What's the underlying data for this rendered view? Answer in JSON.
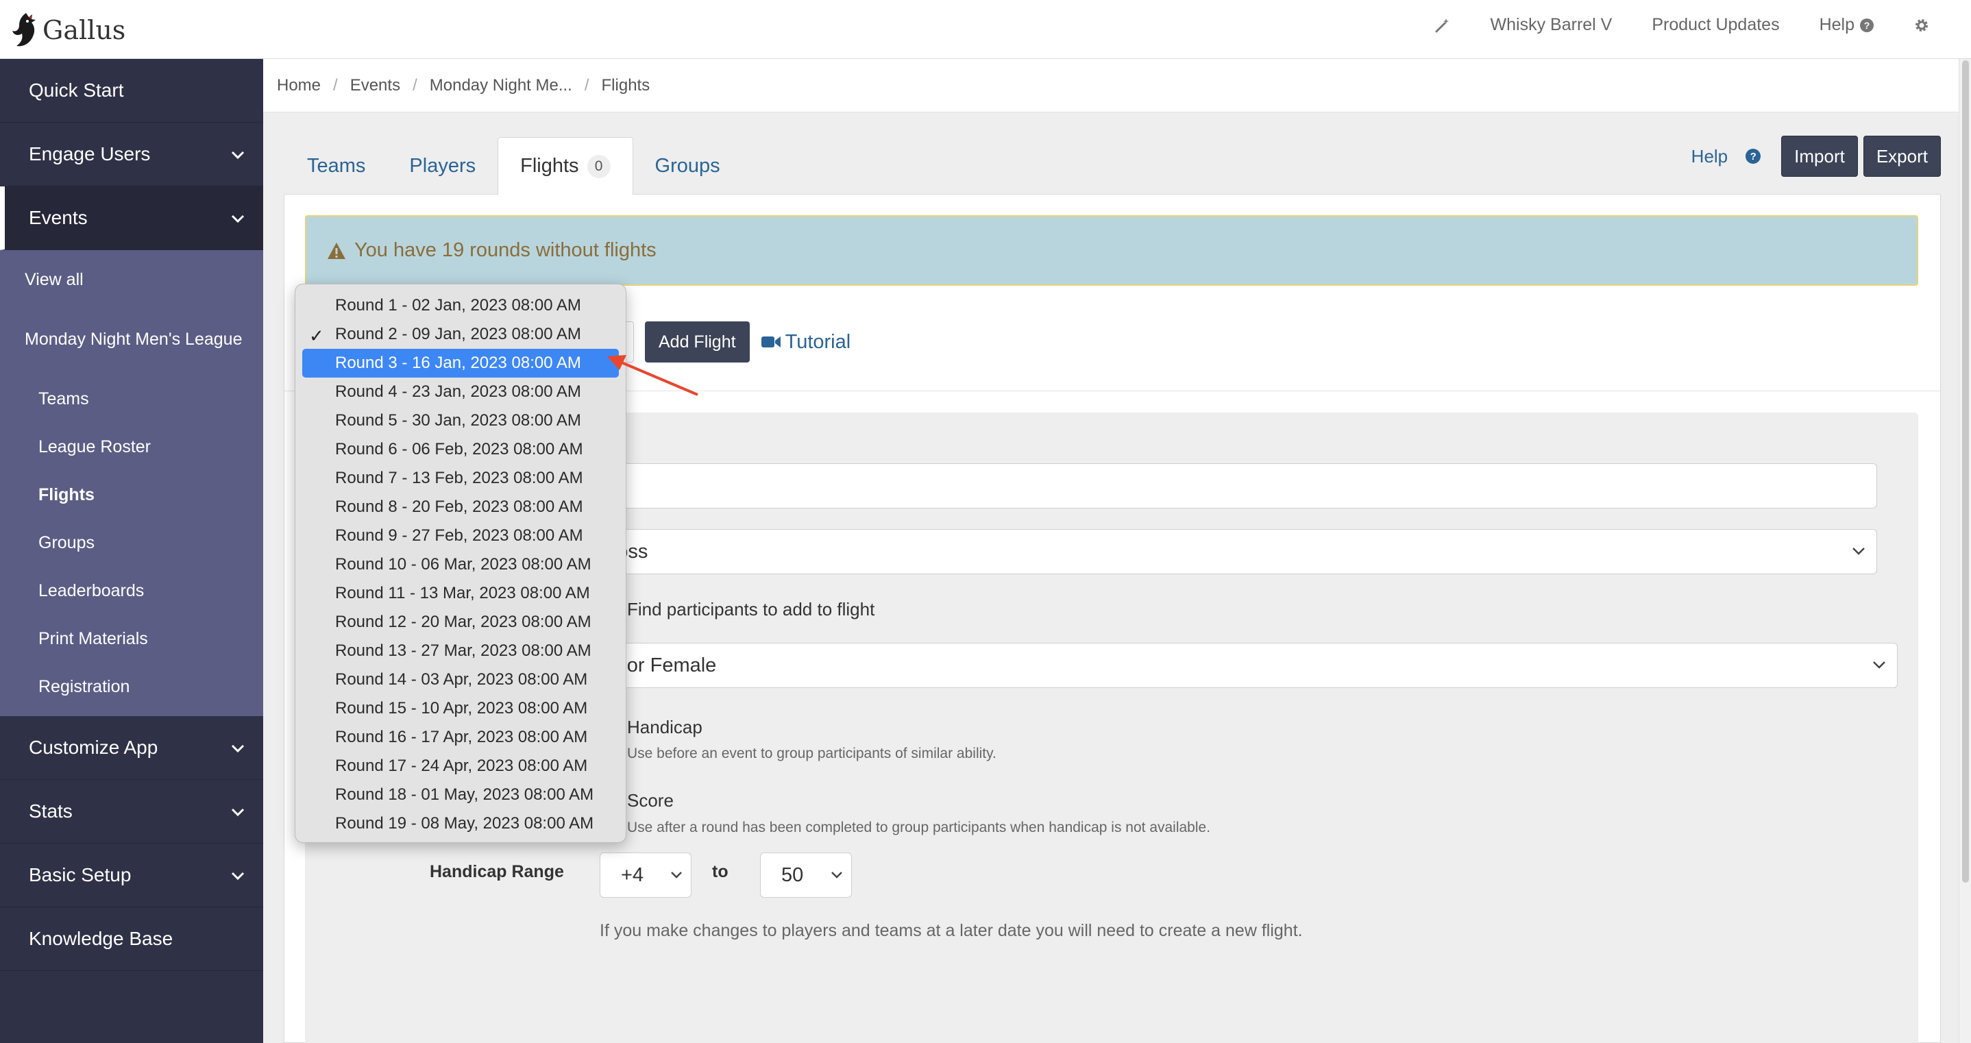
{
  "app": {
    "name": "Gallus"
  },
  "header": {
    "items": [
      {
        "label": ""
      },
      {
        "label": "Whisky Barrel V"
      },
      {
        "label": "Product Updates"
      },
      {
        "label": "Help"
      },
      {
        "label": ""
      }
    ],
    "icons": [
      "magic-wand-icon",
      "question-circle-icon",
      "gear-icon"
    ]
  },
  "sidebar": {
    "items": [
      {
        "label": "Quick Start"
      },
      {
        "label": "Engage Users"
      },
      {
        "label": "Events"
      },
      {
        "label": "Customize App"
      },
      {
        "label": "Stats"
      },
      {
        "label": "Basic Setup"
      },
      {
        "label": "Knowledge Base"
      }
    ],
    "events_sub": [
      {
        "label": "View all"
      },
      {
        "label": "Monday Night Men's League"
      },
      {
        "label": "Teams"
      },
      {
        "label": "League Roster"
      },
      {
        "label": "Flights"
      },
      {
        "label": "Groups"
      },
      {
        "label": "Leaderboards"
      },
      {
        "label": "Print Materials"
      },
      {
        "label": "Registration"
      }
    ]
  },
  "breadcrumb": [
    "Home",
    "Events",
    "Monday Night Me...",
    "Flights"
  ],
  "tabs": [
    {
      "label": "Teams"
    },
    {
      "label": "Players"
    },
    {
      "label": "Flights",
      "count": "0"
    },
    {
      "label": "Groups"
    }
  ],
  "actions": {
    "help": "Help",
    "import": "Import",
    "export": "Export"
  },
  "alert": {
    "text": "You have 19 rounds without flights"
  },
  "toolbar": {
    "add_flight": "Add Flight",
    "tutorial": "Tutorial"
  },
  "form": {
    "scoring_value": "Gross",
    "find_participants": "Find participants to add to flight",
    "gender_value": "ale or Female",
    "handicap_label": "Handicap",
    "handicap_hint": "Use before an event to group participants of similar ability.",
    "score_label": "Score",
    "score_hint": "Use after a round has been completed to group participants when handicap is not available.",
    "handicap_range_label": "Handicap Range",
    "range_from": "+4",
    "range_to_word": "to",
    "range_to": "50",
    "note": "If you make changes to players and teams at a later date you will need to create a new flight."
  },
  "dropdown": {
    "checked_index": 1,
    "highlighted_index": 2,
    "options": [
      "Round 1 - 02 Jan, 2023 08:00 AM",
      "Round 2 - 09 Jan, 2023 08:00 AM",
      "Round 3 - 16 Jan, 2023 08:00 AM",
      "Round 4 - 23 Jan, 2023 08:00 AM",
      "Round 5 - 30 Jan, 2023 08:00 AM",
      "Round 6 - 06 Feb, 2023 08:00 AM",
      "Round 7 - 13 Feb, 2023 08:00 AM",
      "Round 8 - 20 Feb, 2023 08:00 AM",
      "Round 9 - 27 Feb, 2023 08:00 AM",
      "Round 10 - 06 Mar, 2023 08:00 AM",
      "Round 11 - 13 Mar, 2023 08:00 AM",
      "Round 12 - 20 Mar, 2023 08:00 AM",
      "Round 13 - 27 Mar, 2023 08:00 AM",
      "Round 14 - 03 Apr, 2023 08:00 AM",
      "Round 15 - 10 Apr, 2023 08:00 AM",
      "Round 16 - 17 Apr, 2023 08:00 AM",
      "Round 17 - 24 Apr, 2023 08:00 AM",
      "Round 18 - 01 May, 2023 08:00 AM",
      "Round 19 - 08 May, 2023 08:00 AM"
    ]
  },
  "colors": {
    "sidebar": "#2f3146",
    "sidebar_sub": "#5b5d85",
    "link": "#2a6396",
    "highlight": "#3d87f5",
    "alert_bg": "#b8d5dd",
    "annotation_arrow": "#e8472e"
  }
}
